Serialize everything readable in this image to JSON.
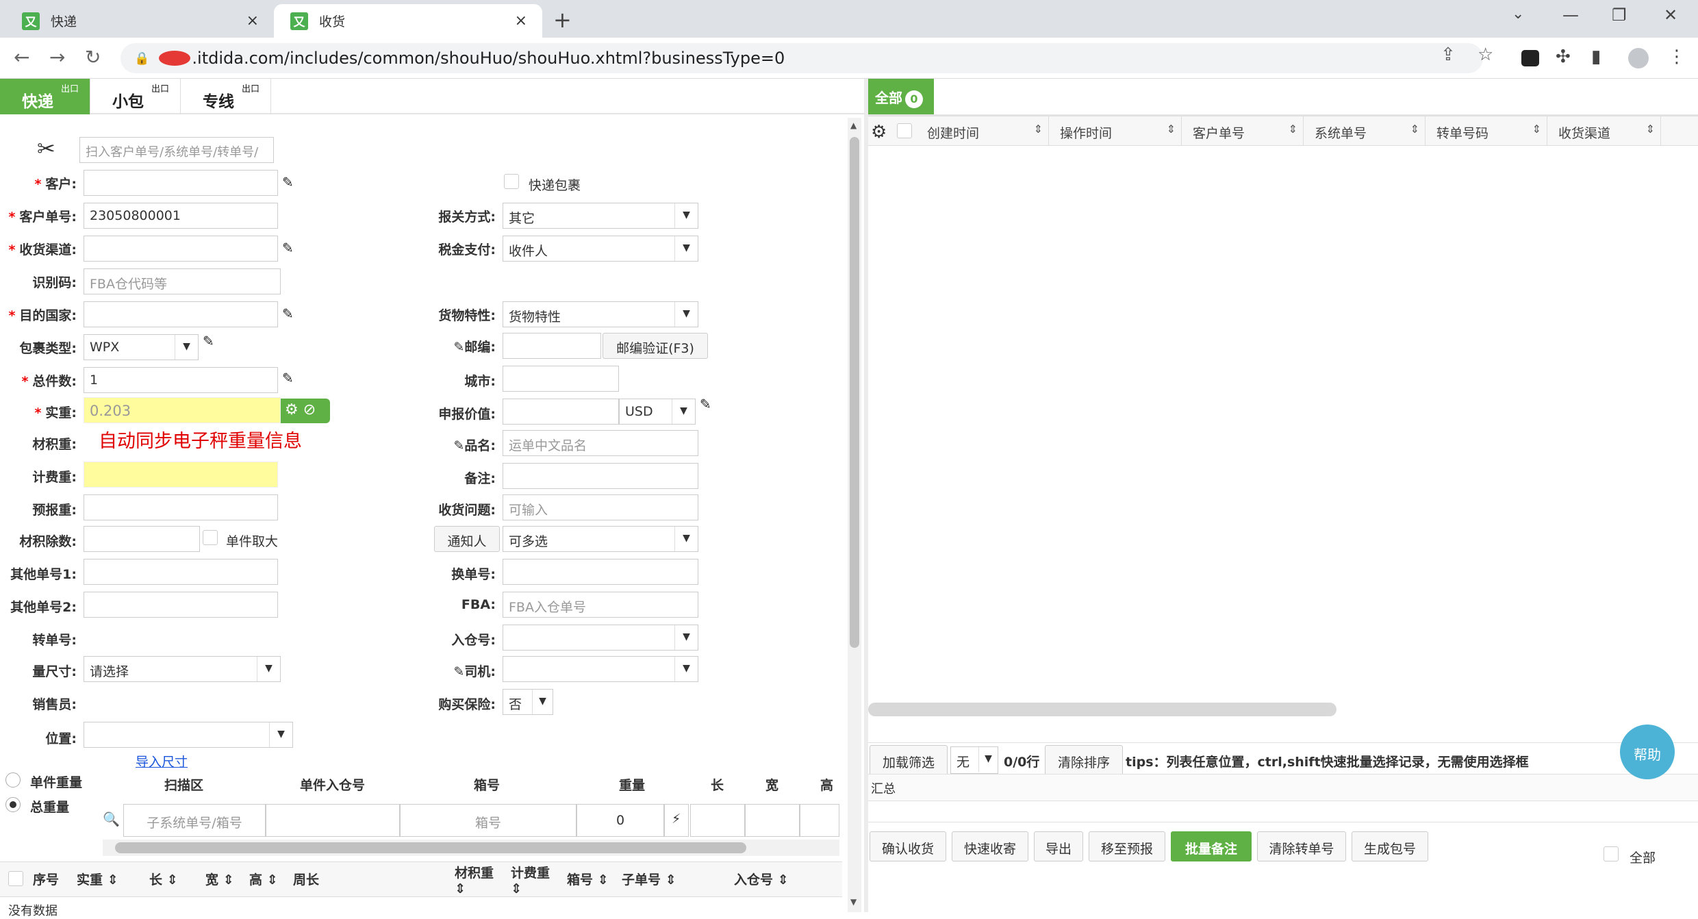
{
  "browser": {
    "tabs": [
      {
        "title": "快递",
        "close": "×"
      },
      {
        "title": "收货",
        "close": "×"
      }
    ],
    "new_tab": "+",
    "url": ".itdida.com/includes/common/shouHuo/shouHuo.xhtml?businessType=0",
    "win_min": "—",
    "win_restore": "❐",
    "win_close": "✕",
    "tab_search": "⌄"
  },
  "app_tabs": [
    {
      "label": "快递",
      "sup": "出口"
    },
    {
      "label": "小包",
      "sup": "出口"
    },
    {
      "label": "专线",
      "sup": "出口"
    }
  ],
  "form": {
    "scan_placeholder": "扫入客户单号/系统单号/转单号/",
    "customer_label": "客户:",
    "customer_no_label": "客户单号:",
    "customer_no_value": "23050800001",
    "channel_label": "收货渠道:",
    "idcode_label": "识别码:",
    "idcode_placeholder": "FBA仓代码等",
    "country_label": "目的国家:",
    "pkg_type_label": "包裹类型:",
    "pkg_type_value": "WPX",
    "total_pcs_label": "总件数:",
    "total_pcs_value": "1",
    "actual_wt_label": "实重:",
    "actual_wt_value": "0.203",
    "vol_wt_label": "材积重:",
    "sync_note": "自动同步电子秤重量信息",
    "charge_wt_label": "计费重:",
    "forecast_wt_label": "预报重:",
    "vol_div_label": "材积除数:",
    "single_max_label": "单件取大",
    "other_no1_label": "其他单号1:",
    "other_no2_label": "其他单号2:",
    "transfer_no_label": "转单号:",
    "measure_label": "量尺寸:",
    "measure_value": "请选择",
    "sales_label": "销售员:",
    "location_label": "位置:",
    "express_pkg_label": "快递包裹",
    "customs_label": "报关方式:",
    "customs_value": "其它",
    "tax_label": "税金支付:",
    "tax_value": "收件人",
    "goods_label": "货物特性:",
    "goods_value": "货物特性",
    "postcode_label": "邮编:",
    "postcode_btn": "邮编验证(F3)",
    "city_label": "城市:",
    "declare_label": "申报价值:",
    "currency_value": "USD",
    "product_label": "品名:",
    "product_placeholder": "运单中文品名",
    "remark_label": "备注:",
    "issue_label": "收货问题:",
    "issue_placeholder": "可输入",
    "notify_btn": "通知人",
    "notify_value": "可多选",
    "swap_no_label": "换单号:",
    "fba_label": "FBA:",
    "fba_placeholder": "FBA入仓单号",
    "warehouse_label": "入仓号:",
    "driver_label": "司机:",
    "insurance_label": "购买保险:",
    "insurance_value": "否"
  },
  "dims": {
    "import_link": "导入尺寸",
    "radio_single": "单件重量",
    "radio_total": "总重量",
    "headers": [
      "扫描区",
      "单件入仓号",
      "箱号",
      "重量",
      "长",
      "宽",
      "高"
    ],
    "sub_placeholder": "子系统单号/箱号",
    "box_placeholder": "箱号",
    "weight_value": "0",
    "bottom_headers": [
      "序号",
      "实重",
      "长",
      "宽",
      "高",
      "周长",
      "材积重",
      "计费重",
      "箱号",
      "子单号",
      "入仓号"
    ],
    "no_data": "没有数据"
  },
  "right": {
    "all_tab": "全部",
    "all_count": "0",
    "columns": [
      "创建时间",
      "操作时间",
      "客户单号",
      "系统单号",
      "转单号码",
      "收货渠道"
    ],
    "load_filter": "加载筛选",
    "filter_value": "无",
    "row_count": "0/0行",
    "clear_sort": "清除排序",
    "tips": "tips：列表任意位置，ctrl,shift快速批量选择记录，无需使用选择框",
    "summary": "汇总",
    "help": "帮助",
    "actions": [
      "确认收货",
      "快速收寄",
      "导出",
      "移至预报",
      "批量备注",
      "清除转单号",
      "生成包号"
    ],
    "all_check": "全部"
  },
  "colors": {
    "accent": "#5fb145",
    "help": "#4db3d6",
    "required": "#e00000",
    "note": "#e00000",
    "highlight": "#fffc9e"
  }
}
